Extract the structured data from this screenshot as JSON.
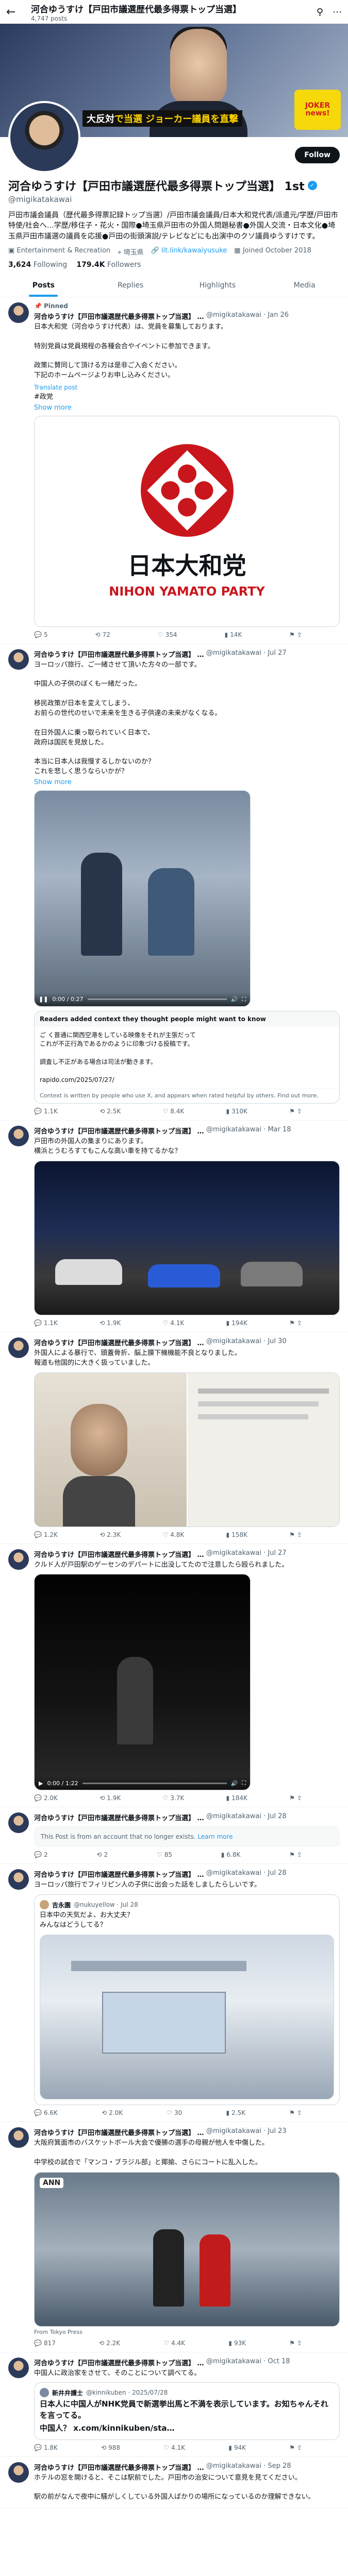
{
  "header": {
    "title": "河合ゆうすけ【戸田市議選歴代最多得票トップ当選】",
    "posts_count": "4,747 posts"
  },
  "banner": {
    "caption_a": "大反対",
    "caption_b": "で当選 ジョーカー議員を直撃",
    "logo_text_1": "JOKER",
    "logo_text_2": "news!"
  },
  "profile": {
    "follow_label": "Follow",
    "name": "河合ゆうすけ【戸田市議選歴代最多得票トップ当選】 1st",
    "handle": "@migikatakawai",
    "bio": "戸田市議会議員（歴代最多得票記録トップ当選）/戸田市議会議員/日本大和党代表/派遣元/学歴/戸田市特使/社会へ…学歴/移住子・花火・国際●埼玉県戸田市の外国人問題秘書●外国人交流・日本文化●埼玉県戸田市議選の議員を応援●戸田の街頭演説/テレビなどにも出演中のクソ議員ゆうすけです。",
    "category": "Entertainment & Recreation",
    "location": "埼玉県",
    "link": "lit.link/kawaiyusuke",
    "joined": "Joined October 2018",
    "following_num": "3,624",
    "following_label": "Following",
    "followers_num": "179.4K",
    "followers_label": "Followers"
  },
  "tabs": [
    {
      "label": "Posts"
    },
    {
      "label": "Replies"
    },
    {
      "label": "Highlights"
    },
    {
      "label": "Media"
    }
  ],
  "posts": [
    {
      "pinned": "Pinned",
      "name": "河合ゆうすけ【戸田市議選歴代最多得票トップ当選】 1st",
      "handle": "@migikatakawai · Jan 26",
      "text": "日本大和党（河合ゆうすけ代表）は、党員を募集しております。\n\n特別党員は党員規程の各種会合やイベントに参加できます。\n\n政策に賛同して頂ける方は是非ご入会ください。\n下記のホームページよりお申し込みください。",
      "translate": "Translate post",
      "hashtags": "#政党",
      "showmore": "Show more",
      "logo_main": "日本大和党",
      "logo_sub": "NIHON YAMATO PARTY",
      "actions": [
        "5",
        "72",
        "354",
        "14K",
        ""
      ]
    },
    {
      "name": "河合ゆうすけ【戸田市議選歴代最多得票トップ当選】 1st",
      "handle": "@migikatakawai · Jul 27",
      "text": "ヨーロッパ旅行、ご一緒させて頂いた方々の一部です。\n\n中国人の子供のぼくも一緒だった。\n\n移民政策が日本を変えてしまう、\nお前らの世代のせいで未来を生きる子供達の未来がなくなる。\n\n在日外国人に乗っ取られていく日本で、\n政府は国民を見放した。\n\n本当に日本人は我慢するしかないのか？\nこれを悲しく思うならいかが？",
      "showmore": "Show more",
      "video_time": "0:00 / 0:27",
      "actions": [
        "1.1K",
        "2.5K",
        "8.4K",
        "310K",
        ""
      ]
    },
    {
      "note_head": "Readers added context they thought people might want to know",
      "note_body": "ご く普通に関西空港をしている映像をそれが主張だって\nこれが不正行為であるかのように印象づける投稿です。\n\n調査し不正がある場合は司法が動きます。\n\nrapido.com/2025/07/27/",
      "note_foot": "Context is written by people who use X, and appears when rated helpful by others. Find out more.",
      "actions": [
        "1.1K",
        "2.5K",
        "8.4K",
        "310K",
        ""
      ]
    },
    {
      "name": "河合ゆうすけ【戸田市議選歴代最多得票トップ当選】 1st",
      "handle": "@migikatakawai · Mar 18",
      "text": "戸田市の外国人の集まりにあります。\n横浜とうむろすてもこんな高い車を持てるかな？",
      "actions": [
        "1.1K",
        "1.9K",
        "4.1K",
        "194K",
        ""
      ]
    },
    {
      "name": "河合ゆうすけ【戸田市議選歴代最多得票トップ当選】 1st",
      "handle": "@migikatakawai · Jul 30",
      "text": "外国人による暴行で、頭蓋骨折、脳上膜下機機能不良となりました。\n報道も他国的に大きく扱っていました。",
      "actions": [
        "1.2K",
        "2.3K",
        "4.8K",
        "158K",
        ""
      ]
    },
    {
      "name": "河合ゆうすけ【戸田市議選歴代最多得票トップ当選】 1st",
      "handle": "@migikatakawai · Jul 27",
      "text": "クルド人が戸田駅のゲーセンのデパートに出没してたので注意したら殴られました。",
      "video_time": "0:00 / 1:22",
      "actions": [
        "2.0K",
        "1.9K",
        "3.7K",
        "184K",
        ""
      ]
    },
    {
      "name": "河合ゆうすけ【戸田市議選歴代最多得票トップ当選】 1st",
      "handle": "@migikatakawai · Jul 28",
      "unavailable": "This Post is from an account that no longer exists.",
      "learn_more": "Learn more",
      "actions": [
        "2",
        "2",
        "85",
        "6.8K",
        ""
      ]
    },
    {
      "name": "河合ゆうすけ【戸田市議選歴代最多得票トップ当選】 1st",
      "handle": "@migikatakawai · Jul 28",
      "text": "ヨーロッパ旅行でフィリピン人の子供に出会った話をしましたらしいです。",
      "quote_name": "吉永園",
      "quote_handle": "@nukuyellow · Jul 28",
      "quote_text": "日本中の天気だよ、お大丈夫？\nみんなはどうしてる？",
      "actions": [
        "6.6K",
        "2.0K",
        "30",
        "2.5K",
        ""
      ]
    },
    {
      "name": "河合ゆうすけ【戸田市議選歴代最多得票トップ当選】 1st",
      "handle": "@migikatakawai · Jul 23",
      "text": "大阪府箕面市のバスケットボール大会で優勝の選手の母親が他人を中傷した。\n\n中学校の試合で「マンコ・ブラジル部」と揶揄、さらにコートに乱入した。",
      "credit": "From Tokyo Press",
      "actions": [
        "817",
        "2.2K",
        "4.4K",
        "93K",
        ""
      ]
    },
    {
      "name": "河合ゆうすけ【戸田市議選歴代最多得票トップ当選】 1st",
      "handle": "@migikatakawai · Oct 18",
      "text": "中国人に政治家をさせて、そのことについて調べてる。",
      "quote_name": "新井弁護士",
      "quote_handle": "@kinnikuben · 2025/07/28",
      "quote_text": "日本人に中国人がNHK党員で新選挙出馬と不満を表示しています。お知ちゃんそれを言ってる。",
      "quote_text2": "中国人？ x.com/kinnikuben/sta…",
      "actions": [
        "1.8K",
        "988",
        "4.1K",
        "94K",
        ""
      ]
    },
    {
      "name": "河合ゆうすけ【戸田市議選歴代最多得票トップ当選】 1st",
      "handle": "@migikatakawai · Sep 28",
      "text": "ホテルの窓を開けると、そこは駅前でした。戸田市の治安について意見を見てください。\n\n駅の前がなんで夜中に騒がしくしている外国人ばかりの場所になっているのか理解できない。",
      "actions": [
        "",
        "",
        "",
        "",
        ""
      ]
    }
  ]
}
